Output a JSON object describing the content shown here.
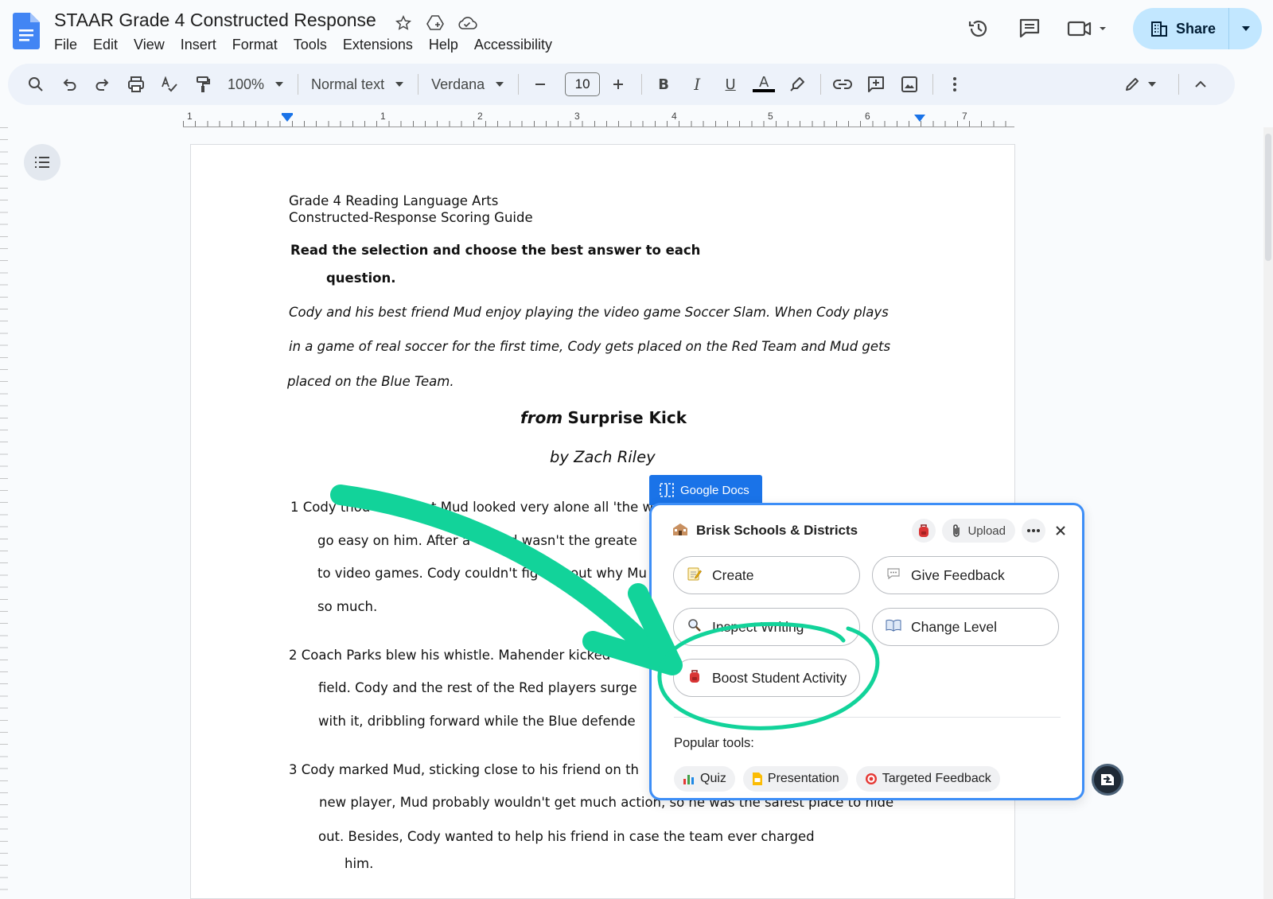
{
  "app": {
    "doc_title": "STAAR Grade 4 Constructed Response",
    "menu": [
      "File",
      "Edit",
      "View",
      "Insert",
      "Format",
      "Tools",
      "Extensions",
      "Help",
      "Accessibility"
    ],
    "share_label": "Share"
  },
  "toolbar": {
    "zoom": "100%",
    "style": "Normal text",
    "font": "Verdana",
    "font_size": "10",
    "bold": "B",
    "italic": "I",
    "underline": "U",
    "text_color": "A"
  },
  "ruler": {
    "numbers": [
      "1",
      "1",
      "2",
      "3",
      "4",
      "5",
      "6",
      "7"
    ]
  },
  "document": {
    "header1": "Grade 4 Reading Language Arts",
    "header2": "Constructed-Response Scoring Guide",
    "instruction1": "Read the selection and choose the best answer to each",
    "instruction2": "question.",
    "intro1": "Cody and his best friend Mud enjoy playing the video game Soccer Slam. When Cody plays",
    "intro2": "in a game of real soccer for the first time, Cody gets placed on the Red Team and Mud gets",
    "intro3": "placed on the Blue Team.",
    "story_from": "from",
    "story_title": "Surprise Kick",
    "byline": "by Zach Riley",
    "p1_l1": "1 Cody thou",
    "p1_l1b": "t Mud looked very alone all 'the w",
    "p1_l2": "go easy on him. After a",
    "p1_l2b": "d wasn't the greate",
    "p1_l3": "to video games. Cody couldn't fig",
    "p1_l3b": "out why Mu",
    "p1_l4": "so much.",
    "p2_l1": "2 Coach Parks blew his whistle. Mahender kicked",
    "p2_l2": "field. Cody and the rest of the Red players surge",
    "p2_l3": "with it, dribbling forward while the Blue defende",
    "p3_l1": "3 Cody marked Mud, sticking close to his friend on th",
    "p3_l2": "new player, Mud probably wouldn't get much action, so he was the safest place to hide",
    "p3_l3": "out. Besides, Cody wanted to help his friend in case the team ever charged",
    "p3_l4": "him."
  },
  "brisk": {
    "tab_label": "Google Docs",
    "org_name": "Brisk Schools & Districts",
    "upload_label": "Upload",
    "buttons": {
      "create": "Create",
      "give_feedback": "Give Feedback",
      "inspect_writing": "Inspect Writing",
      "change_level": "Change Level",
      "boost_student_activity": "Boost Student Activity"
    },
    "popular_label": "Popular tools:",
    "chips": {
      "quiz": "Quiz",
      "presentation": "Presentation",
      "targeted_feedback": "Targeted Feedback"
    }
  },
  "colors": {
    "accent": "#1a73e8",
    "panel_border": "#3d8ef7",
    "annotation_green": "#12d39a",
    "share_bg": "#c2e7ff"
  }
}
